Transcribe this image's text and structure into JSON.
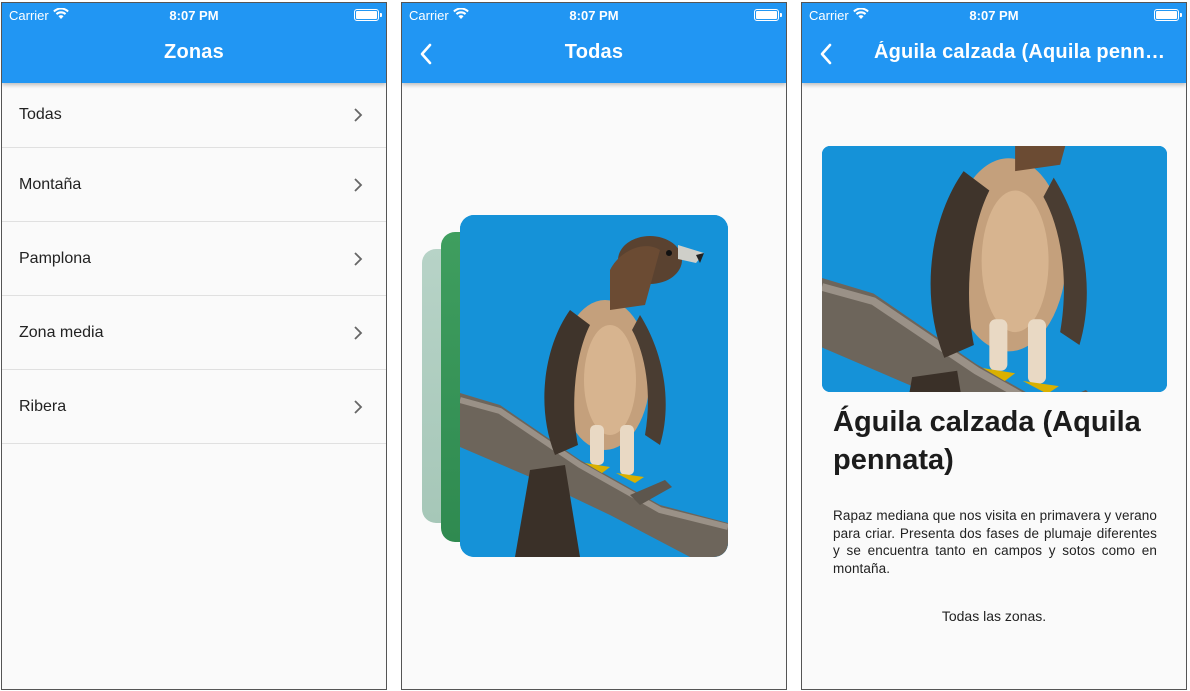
{
  "status": {
    "carrier": "Carrier",
    "time": "8:07 PM"
  },
  "screens": [
    {
      "title": "Zonas",
      "zones": [
        "Todas",
        "Montaña",
        "Pamplona",
        "Zona media",
        "Ribera"
      ]
    },
    {
      "title": "Todas"
    },
    {
      "title": "Águila calzada (Aquila pennata)",
      "heading": "Águila calzada (Aquila pennata)",
      "description": "Rapaz mediana que nos visita en primavera y verano para criar. Presenta dos fases de plumaje diferentes y se encuentra tanto en campos y sotos como en montaña.",
      "zones": "Todas las zonas."
    }
  ],
  "colors": {
    "appbar": "#2196f3",
    "background": "#fafafa",
    "sky": "#1592d8"
  },
  "icons": [
    "wifi-icon",
    "battery-icon",
    "chevron-right-icon",
    "back-arrow-icon"
  ]
}
